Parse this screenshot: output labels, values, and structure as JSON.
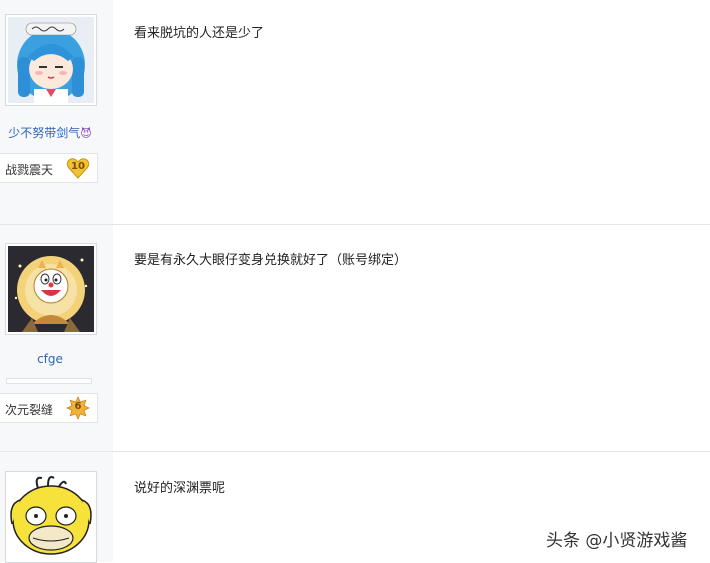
{
  "posts": [
    {
      "username": "少不努带剑气",
      "username_emoji": "😈",
      "level_title": "战戮震天",
      "level": "10",
      "level_color": "#f2c230",
      "content": "看来脱坑的人还是少了"
    },
    {
      "username": "cfge",
      "level_title": "次元裂缝",
      "level": "6",
      "level_color": "#f1b23a",
      "content": "要是有永久大眼仔变身兑换就好了（账号绑定）"
    },
    {
      "content": "说好的深渊票呢"
    }
  ],
  "watermark": "头条 @小贤游戏酱"
}
